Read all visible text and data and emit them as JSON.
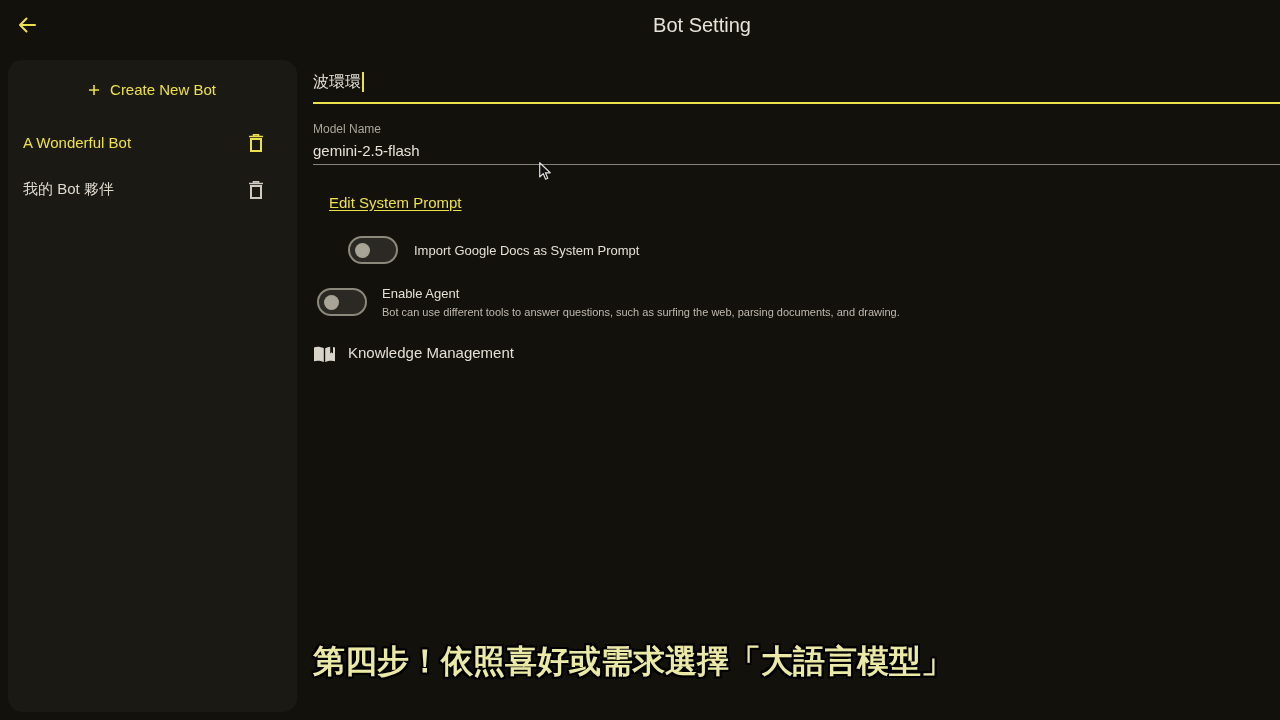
{
  "header": {
    "title": "Bot Setting"
  },
  "sidebar": {
    "create_button": "Create New Bot",
    "bots": [
      {
        "name": "A Wonderful Bot",
        "selected": true
      },
      {
        "name": "我的 Bot 夥伴",
        "selected": false
      }
    ]
  },
  "form": {
    "name_field": {
      "value": "波環環",
      "focused": true
    },
    "model_field": {
      "label": "Model Name",
      "value": "gemini-2.5-flash",
      "focused": false
    },
    "system_prompt": {
      "link": "Edit System Prompt",
      "options": [
        {
          "label": "Import Google Docs as System Prompt",
          "on": false
        }
      ]
    },
    "settings": [
      {
        "kind": "toggle",
        "label": "Enable Agent",
        "description": "Bot can use different tools to answer questions, such as surfing the web, parsing documents, and drawing.",
        "on": false
      },
      {
        "kind": "link",
        "label": "Knowledge Management"
      }
    ]
  },
  "caption": "第四步！依照喜好或需求選擇「大語言模型」"
}
